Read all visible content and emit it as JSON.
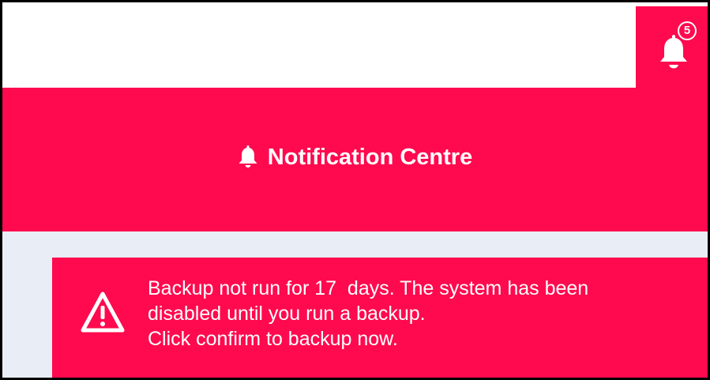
{
  "topbar": {
    "notification_count": "5"
  },
  "header": {
    "title": "Notification Centre",
    "icon": "bell-icon"
  },
  "alert": {
    "icon": "warning-triangle-icon",
    "lines": [
      "Backup not run for 17  days. The system has been",
      "disabled until you run a backup.",
      "Click confirm to backup now."
    ]
  },
  "colors": {
    "accent": "#ff0a4e",
    "background": "#e9edf5",
    "text_on_accent": "#ffffff",
    "border": "#000000"
  }
}
